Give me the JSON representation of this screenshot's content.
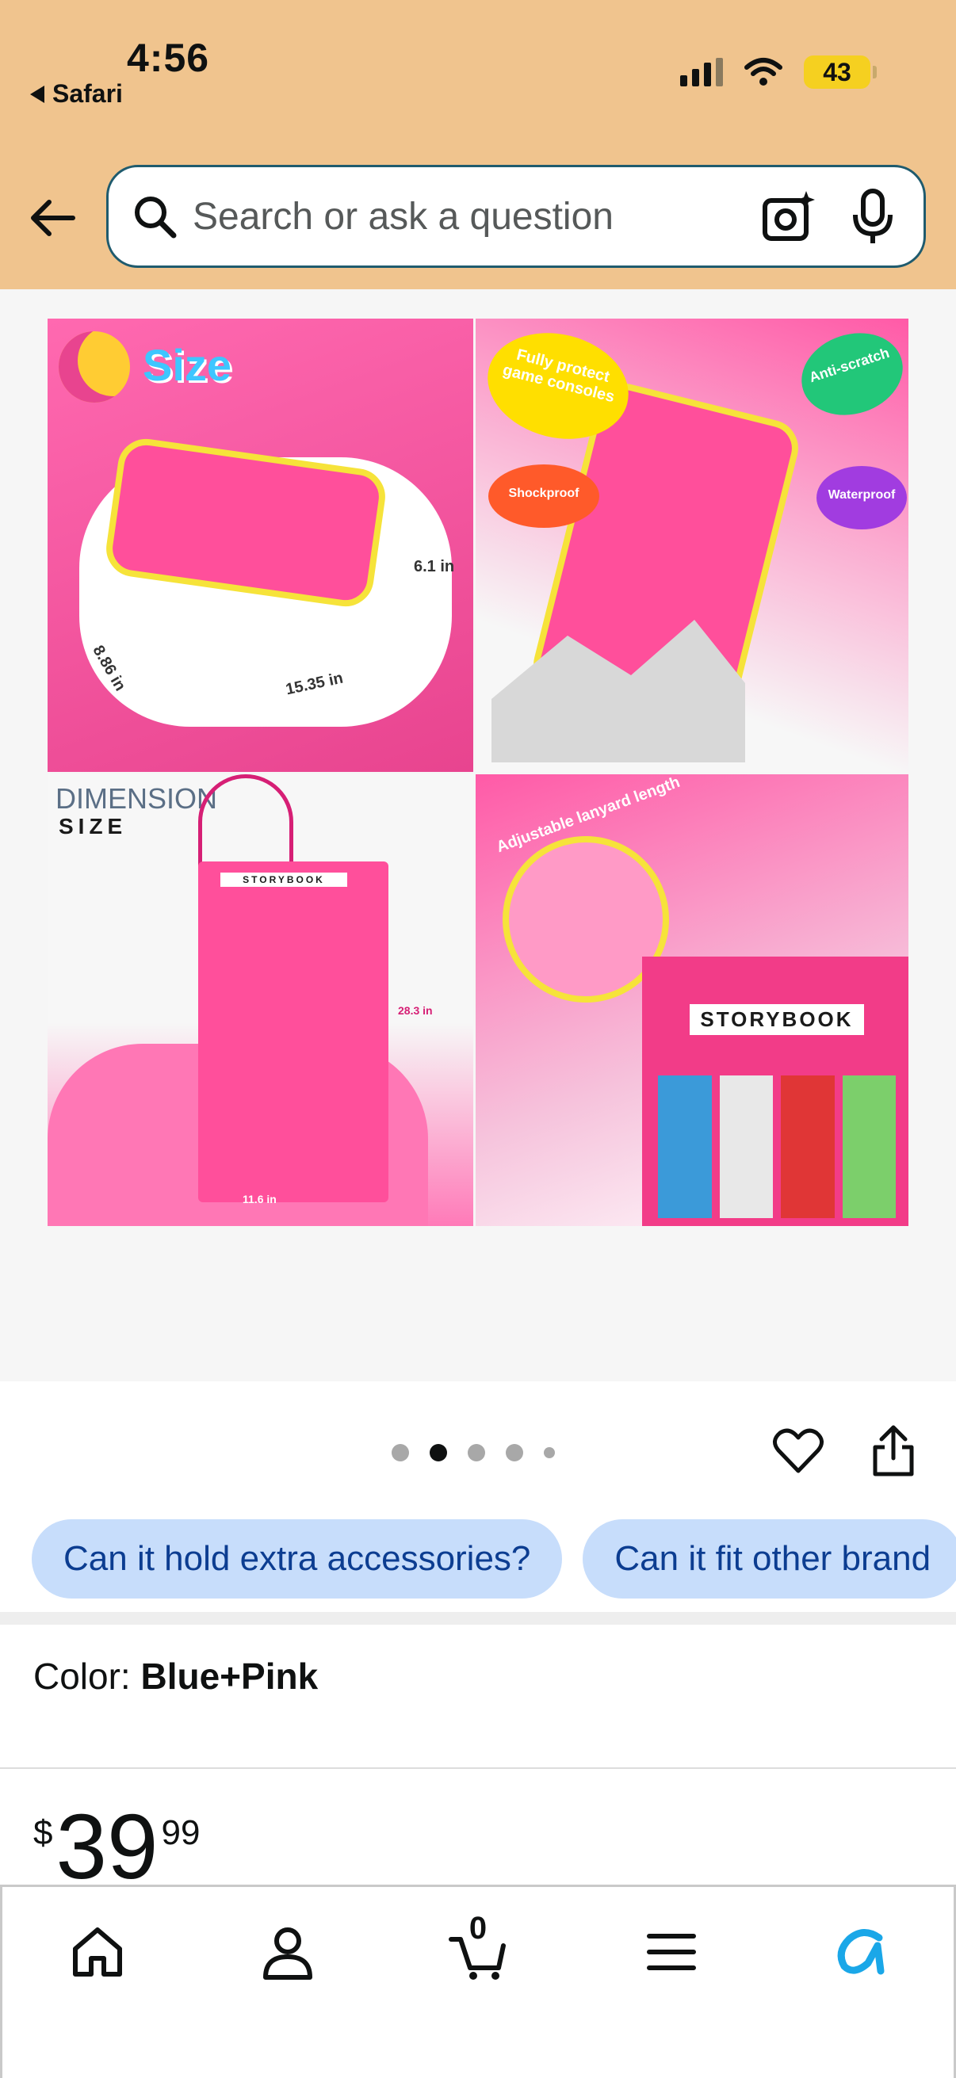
{
  "status_bar": {
    "time": "4:56",
    "back_app": "Safari",
    "battery": "43"
  },
  "search": {
    "placeholder": "Search or ask a question"
  },
  "gallery": {
    "tile1": {
      "title": "Size",
      "dims": [
        "6.1 in",
        "8.86 in",
        "15.35 in"
      ]
    },
    "tile2": {
      "badges": [
        "Fully protect game consoles",
        "Anti-scratch",
        "Shockproof",
        "Waterproof"
      ]
    },
    "tile3": {
      "title": "DIMENSION",
      "subtitle": "SIZE",
      "dims": [
        "28.3 in",
        "11.6 in"
      ],
      "label": "STORYBOOK"
    },
    "tile4": {
      "caption": "Adjustable lanyard length",
      "label": "STORYBOOK"
    },
    "dots_count": 5,
    "active_dot": 2
  },
  "chips": [
    "Can it hold extra accessories?",
    "Can it fit other brand"
  ],
  "color": {
    "label": "Color:",
    "value": "Blue+Pink"
  },
  "price": {
    "symbol": "$",
    "whole": "39",
    "cents": "99"
  },
  "tabbar": {
    "cart_count": "0"
  },
  "colors": {
    "header_bg": "#f0c48e",
    "chip_bg": "#c7ddfb",
    "chip_text": "#0c3d91",
    "accent": "#1aa7e8"
  }
}
